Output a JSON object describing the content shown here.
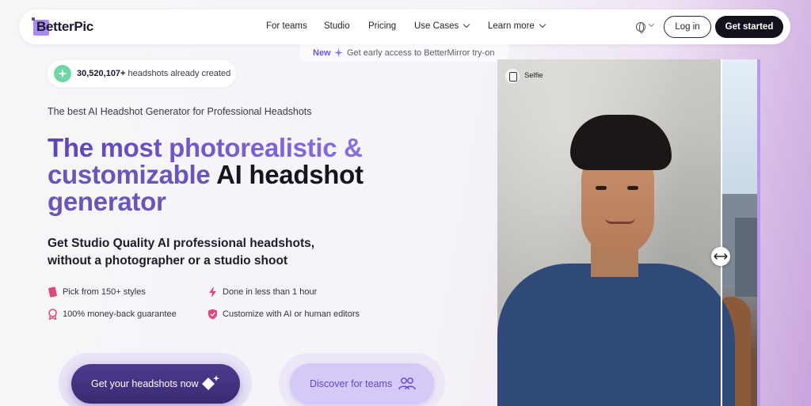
{
  "nav": {
    "logo": "BetterPic",
    "links": [
      "For teams",
      "Studio",
      "Pricing",
      "Use Cases",
      "Learn more"
    ],
    "login": "Log in",
    "get_started": "Get started"
  },
  "banner": {
    "badge": "New",
    "text": "Get early access to BetterMirror try-on"
  },
  "stat": {
    "count": "30,520,107+",
    "text": "headshots already created"
  },
  "hero": {
    "tagline": "The best AI Headshot Generator for Professional Headshots",
    "headline_part1": "The most photorealistic &",
    "headline_part2": "customizable",
    "headline_part3": "AI headshot",
    "headline_part4": "generator",
    "sub_line1": "Get Studio Quality AI professional headshots,",
    "sub_line2": "without a photographer or a studio shoot"
  },
  "features": [
    "Pick from 150+ styles",
    "Done in less than 1 hour",
    "100% money-back guarantee",
    "Customize with AI or human editors"
  ],
  "cta": {
    "primary": "Get your headshots now",
    "secondary": "Discover for teams"
  },
  "photo": {
    "label": "Selfie"
  },
  "colors": {
    "accent": "#6b57e2",
    "primary_button": "#3f2e7a",
    "secondary_button": "#d5c9f7"
  }
}
